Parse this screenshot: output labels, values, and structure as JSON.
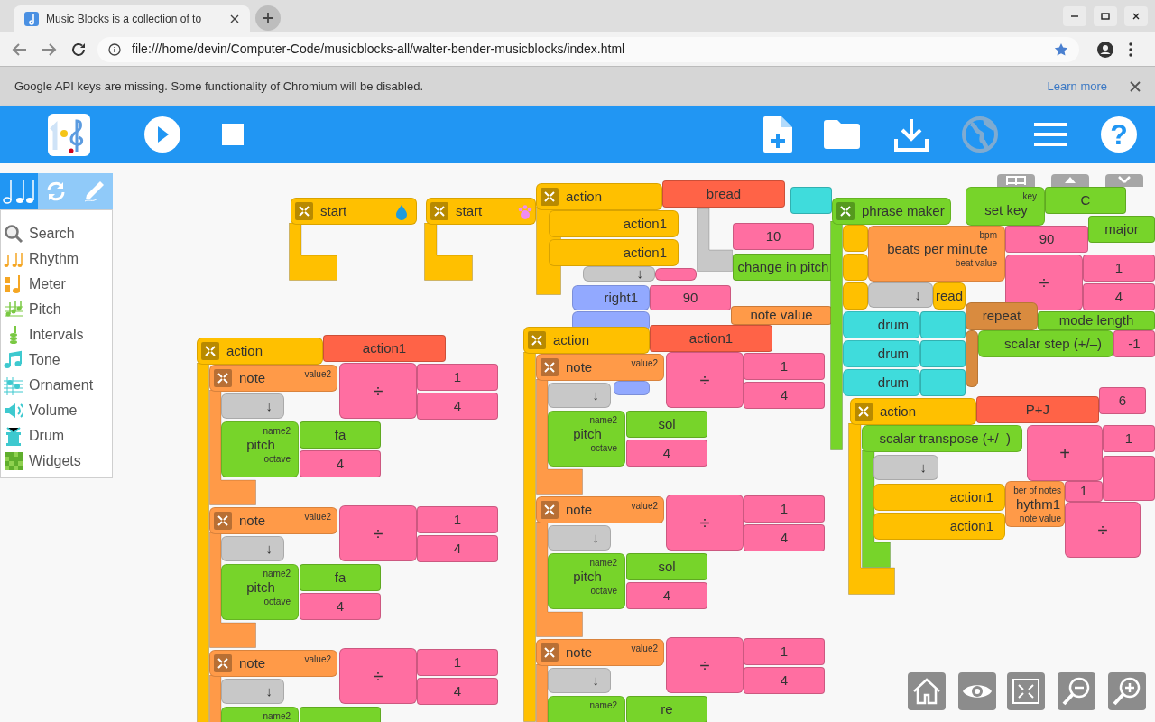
{
  "browser": {
    "tab_title": "Music Blocks is a collection of to",
    "url": "file:///home/devin/Computer-Code/musicblocks-all/walter-bender-musicblocks/index.html",
    "infobar": {
      "message": "Google API keys are missing. Some functionality of Chromium will be disabled.",
      "link": "Learn more"
    }
  },
  "toolbar": [
    {
      "kind": "logo",
      "disabled": false
    },
    {
      "kind": "play",
      "disabled": false
    },
    {
      "kind": "stop",
      "disabled": false
    },
    {
      "kind": "new",
      "disabled": false
    },
    {
      "kind": "open",
      "disabled": false
    },
    {
      "kind": "save",
      "disabled": false
    },
    {
      "kind": "planet",
      "disabled": true
    },
    {
      "kind": "menu",
      "disabled": false
    },
    {
      "kind": "help",
      "label": "?",
      "disabled": false
    }
  ],
  "palette": {
    "tabs": [
      {
        "kind": "music",
        "selected": true
      },
      {
        "kind": "flow",
        "selected": false
      },
      {
        "kind": "art",
        "selected": false
      }
    ],
    "items": [
      {
        "kind": "search",
        "label": "Search"
      },
      {
        "kind": "rhythm",
        "label": "Rhythm"
      },
      {
        "kind": "meter",
        "label": "Meter"
      },
      {
        "kind": "pitch",
        "label": "Pitch"
      },
      {
        "kind": "intervals",
        "label": "Intervals"
      },
      {
        "kind": "tone",
        "label": "Tone"
      },
      {
        "kind": "ornament",
        "label": "Ornament"
      },
      {
        "kind": "volume",
        "label": "Volume"
      },
      {
        "kind": "drum",
        "label": "Drum"
      },
      {
        "kind": "widgets",
        "label": "Widgets"
      }
    ]
  },
  "canvas": {
    "corner_buttons": [
      {
        "kind": "grid"
      },
      {
        "kind": "collapse"
      },
      {
        "kind": "shrink"
      }
    ],
    "pieces": [
      {
        "kind": "clamp",
        "color": "#ffc000"
      },
      {
        "kind": "hat",
        "color": "#ffc000",
        "text": "start"
      },
      {
        "kind": "clamp",
        "color": "#ffc000"
      },
      {
        "kind": "hat",
        "color": "#ffc000",
        "text": "start"
      },
      {
        "kind": "value",
        "color": "#3fdcdc"
      },
      {
        "kind": "op",
        "color": "#ff6ea1"
      },
      {
        "kind": "value",
        "color": "#ff6ea1",
        "text": "10"
      },
      {
        "kind": "value",
        "color": "#77d42a",
        "text": "change in pitch"
      },
      {
        "kind": "clamp",
        "color": "#c8c8c8"
      },
      {
        "kind": "cmd",
        "color": "#92a9ff",
        "text": "right1"
      },
      {
        "kind": "value",
        "color": "#ff6ea1",
        "text": "90"
      },
      {
        "kind": "cmd",
        "color": "#92a9ff"
      },
      {
        "kind": "value",
        "color": "#ff9a48",
        "text": "note value"
      },
      {
        "kind": "cmd",
        "color": "#92a9ff"
      },
      {
        "kind": "cmd",
        "color": "#c8c8c8",
        "text": "↓"
      },
      {
        "kind": "clamp",
        "color": "#ffc000"
      },
      {
        "kind": "hat",
        "color": "#ffc000",
        "text": "action"
      },
      {
        "kind": "value",
        "color": "#ff6347",
        "text": "bread"
      },
      {
        "kind": "cmd",
        "color": "#ffc000",
        "text": "action1"
      },
      {
        "kind": "cmd",
        "color": "#ffc000",
        "text": "action1"
      },
      {
        "kind": "clamp",
        "color": "#ffc000"
      },
      {
        "kind": "hat",
        "color": "#ffc000",
        "text": "action"
      },
      {
        "kind": "value",
        "color": "#ff6347",
        "text": "action1"
      },
      {
        "kind": "clamp",
        "color": "#ff9a48"
      },
      {
        "kind": "hat",
        "color": "#ff9a48",
        "text": "note",
        "labels": [
          "value2"
        ]
      },
      {
        "kind": "op",
        "color": "#ff6ea1",
        "text": "÷"
      },
      {
        "kind": "value",
        "color": "#ff6ea1",
        "text": "1"
      },
      {
        "kind": "cmd",
        "color": "#c8c8c8",
        "text": "↓"
      },
      {
        "kind": "value",
        "color": "#ff6ea1",
        "text": "4"
      },
      {
        "kind": "cmd",
        "color": "#77d42a",
        "text": "pitch",
        "labels": [
          "name2",
          "octave"
        ]
      },
      {
        "kind": "value",
        "color": "#77d42a",
        "text": "fa"
      },
      {
        "kind": "value",
        "color": "#ff6ea1",
        "text": "4"
      },
      {
        "kind": "clamp",
        "color": "#ff9a48"
      },
      {
        "kind": "hat",
        "color": "#ff9a48",
        "text": "note",
        "labels": [
          "value2"
        ]
      },
      {
        "kind": "op",
        "color": "#ff6ea1",
        "text": "÷"
      },
      {
        "kind": "value",
        "color": "#ff6ea1",
        "text": "1"
      },
      {
        "kind": "cmd",
        "color": "#c8c8c8",
        "text": "↓"
      },
      {
        "kind": "value",
        "color": "#ff6ea1",
        "text": "4"
      },
      {
        "kind": "cmd",
        "color": "#77d42a",
        "text": "pitch",
        "labels": [
          "name2",
          "octave"
        ]
      },
      {
        "kind": "value",
        "color": "#77d42a",
        "text": "fa"
      },
      {
        "kind": "value",
        "color": "#ff6ea1",
        "text": "4"
      },
      {
        "kind": "clamp",
        "color": "#ff9a48"
      },
      {
        "kind": "hat",
        "color": "#ff9a48",
        "text": "note",
        "labels": [
          "value2"
        ]
      },
      {
        "kind": "op",
        "color": "#ff6ea1",
        "text": "÷"
      },
      {
        "kind": "value",
        "color": "#ff6ea1",
        "text": "1"
      },
      {
        "kind": "cmd",
        "color": "#c8c8c8",
        "text": "↓"
      },
      {
        "kind": "value",
        "color": "#ff6ea1",
        "text": "4"
      },
      {
        "kind": "cmd",
        "color": "#77d42a",
        "labels": [
          "name2"
        ]
      },
      {
        "kind": "value",
        "color": "#77d42a"
      },
      {
        "kind": "clamp",
        "color": "#ffc000"
      },
      {
        "kind": "hat",
        "color": "#ffc000",
        "text": "action"
      },
      {
        "kind": "value",
        "color": "#ff6347",
        "text": "action1"
      },
      {
        "kind": "clamp",
        "color": "#ff9a48"
      },
      {
        "kind": "hat",
        "color": "#ff9a48",
        "text": "note",
        "labels": [
          "value2"
        ]
      },
      {
        "kind": "op",
        "color": "#ff6ea1",
        "text": "÷"
      },
      {
        "kind": "value",
        "color": "#ff6ea1",
        "text": "1"
      },
      {
        "kind": "cmd",
        "color": "#c8c8c8",
        "text": "↓"
      },
      {
        "kind": "value",
        "color": "#ff6ea1",
        "text": "4"
      },
      {
        "kind": "cmd",
        "color": "#77d42a",
        "text": "pitch",
        "labels": [
          "name2",
          "octave"
        ]
      },
      {
        "kind": "value",
        "color": "#77d42a",
        "text": "sol"
      },
      {
        "kind": "value",
        "color": "#ff6ea1",
        "text": "4"
      },
      {
        "kind": "clamp",
        "color": "#ff9a48"
      },
      {
        "kind": "hat",
        "color": "#ff9a48",
        "text": "note",
        "labels": [
          "value2"
        ]
      },
      {
        "kind": "op",
        "color": "#ff6ea1",
        "text": "÷"
      },
      {
        "kind": "value",
        "color": "#ff6ea1",
        "text": "1"
      },
      {
        "kind": "cmd",
        "color": "#c8c8c8",
        "text": "↓"
      },
      {
        "kind": "value",
        "color": "#ff6ea1",
        "text": "4"
      },
      {
        "kind": "cmd",
        "color": "#77d42a",
        "text": "pitch",
        "labels": [
          "name2",
          "octave"
        ]
      },
      {
        "kind": "value",
        "color": "#77d42a",
        "text": "sol"
      },
      {
        "kind": "value",
        "color": "#ff6ea1",
        "text": "4"
      },
      {
        "kind": "clamp",
        "color": "#ff9a48"
      },
      {
        "kind": "hat",
        "color": "#ff9a48",
        "text": "note",
        "labels": [
          "value2"
        ]
      },
      {
        "kind": "op",
        "color": "#ff6ea1",
        "text": "÷"
      },
      {
        "kind": "value",
        "color": "#ff6ea1",
        "text": "1"
      },
      {
        "kind": "cmd",
        "color": "#c8c8c8",
        "text": "↓"
      },
      {
        "kind": "value",
        "color": "#ff6ea1",
        "text": "4"
      },
      {
        "kind": "cmd",
        "color": "#77d42a",
        "labels": [
          "name2"
        ]
      },
      {
        "kind": "value",
        "color": "#77d42a",
        "text": "re"
      },
      {
        "kind": "clamp",
        "color": "#77d42a"
      },
      {
        "kind": "hat",
        "color": "#77d42a",
        "text": "phrase maker"
      },
      {
        "kind": "cmd",
        "color": "#ffc000"
      },
      {
        "kind": "cmd",
        "color": "#ffc000"
      },
      {
        "kind": "cmd",
        "color": "#ffc000"
      },
      {
        "kind": "cmd",
        "color": "#c8c8c8",
        "text": "↓"
      },
      {
        "kind": "cmd",
        "color": "#ffc000",
        "text": "read"
      },
      {
        "kind": "cmd",
        "color": "#3fdcdc",
        "text": "drum"
      },
      {
        "kind": "value",
        "color": "#3fdcdc"
      },
      {
        "kind": "cmd",
        "color": "#3fdcdc",
        "text": "drum"
      },
      {
        "kind": "value",
        "color": "#3fdcdc"
      },
      {
        "kind": "cmd",
        "color": "#3fdcdc",
        "text": "drum"
      },
      {
        "kind": "value",
        "color": "#3fdcdc"
      },
      {
        "kind": "cmd",
        "color": "#77d42a",
        "text": "set key",
        "labels": [
          "key"
        ]
      },
      {
        "kind": "value",
        "color": "#77d42a",
        "text": "C"
      },
      {
        "kind": "value",
        "color": "#77d42a",
        "text": "major"
      },
      {
        "kind": "value",
        "color": "#77d42a",
        "text": "mode length"
      },
      {
        "kind": "cmd",
        "color": "#ff9a48",
        "text": "beats per minute",
        "labels": [
          "bpm",
          "beat value"
        ]
      },
      {
        "kind": "value",
        "color": "#ff6ea1",
        "text": "90"
      },
      {
        "kind": "op",
        "color": "#ff6ea1",
        "text": "÷"
      },
      {
        "kind": "value",
        "color": "#ff6ea1",
        "text": "1"
      },
      {
        "kind": "value",
        "color": "#ff6ea1",
        "text": "4"
      },
      {
        "kind": "cmd",
        "color": "#d98b3f",
        "text": "repeat"
      },
      {
        "kind": "cmd",
        "color": "#d98b3f"
      },
      {
        "kind": "cmd",
        "color": "#77d42a",
        "text": "scalar step (+/–)"
      },
      {
        "kind": "value",
        "color": "#ff6ea1",
        "text": "-1"
      },
      {
        "kind": "cmd",
        "color": "#ff9a48",
        "text": "hythm1",
        "labels": [
          "ber of notes",
          "note value"
        ]
      },
      {
        "kind": "value",
        "color": "#ff6ea1",
        "text": "6"
      },
      {
        "kind": "value",
        "color": "#ff6ea1",
        "text": "1"
      },
      {
        "kind": "clamp",
        "color": "#ffc000"
      },
      {
        "kind": "hat",
        "color": "#ffc000",
        "text": "action"
      },
      {
        "kind": "value",
        "color": "#ff6347",
        "text": "P+J"
      },
      {
        "kind": "clamp",
        "color": "#77d42a"
      },
      {
        "kind": "cmd",
        "color": "#77d42a",
        "text": "scalar transpose (+/–)"
      },
      {
        "kind": "cmd",
        "color": "#c8c8c8",
        "text": "↓"
      },
      {
        "kind": "cmd",
        "color": "#ffc000",
        "text": "action1"
      },
      {
        "kind": "cmd",
        "color": "#ffc000",
        "text": "action1"
      },
      {
        "kind": "op",
        "color": "#ff6ea1",
        "text": "+"
      },
      {
        "kind": "value",
        "color": "#ff6ea1",
        "text": "1"
      },
      {
        "kind": "value",
        "color": "#ff6ea1"
      },
      {
        "kind": "op",
        "color": "#ff6ea1",
        "text": "÷"
      }
    ],
    "controls": [
      {
        "kind": "home"
      },
      {
        "kind": "eye"
      },
      {
        "kind": "fit"
      },
      {
        "kind": "zoom_out"
      },
      {
        "kind": "zoom_in"
      }
    ]
  }
}
